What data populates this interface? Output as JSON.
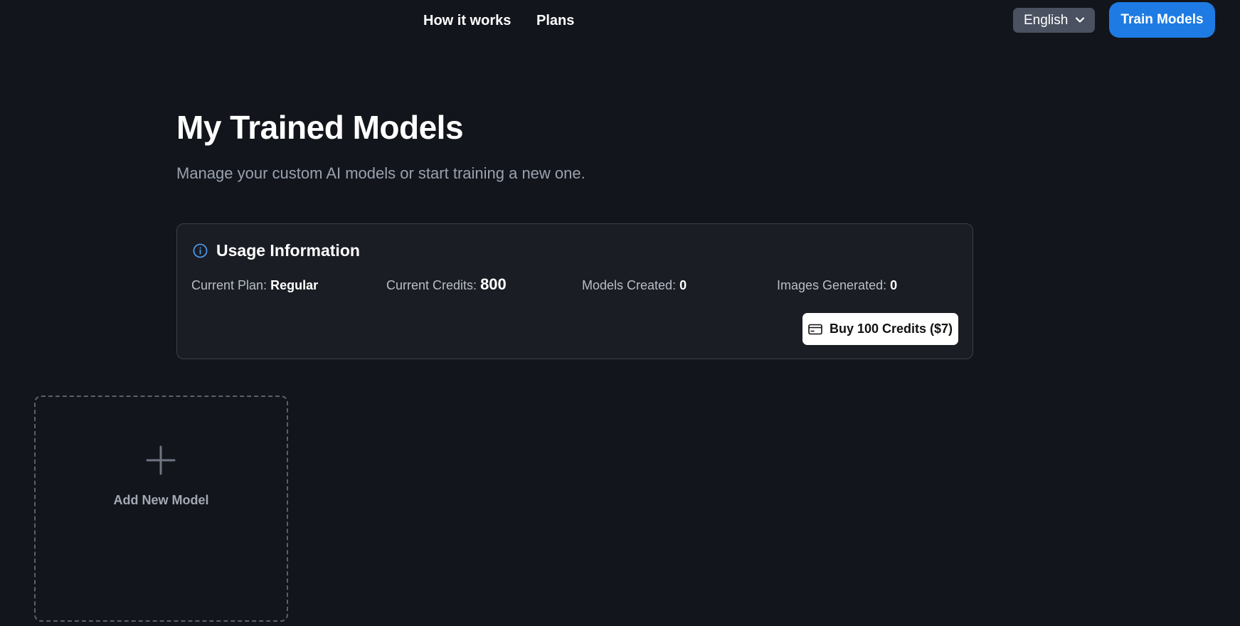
{
  "nav": {
    "how_it_works": "How it works",
    "plans": "Plans",
    "language": "English",
    "train_models": "Train Models"
  },
  "header": {
    "title": "My Trained Models",
    "subtitle": "Manage your custom AI models or start training a new one."
  },
  "usage": {
    "title": "Usage Information",
    "plan_label": "Current Plan:",
    "plan_value": "Regular",
    "credits_label": "Current Credits:",
    "credits_value": "800",
    "models_label": "Models Created:",
    "models_value": "0",
    "images_label": "Images Generated:",
    "images_value": "0",
    "buy_button": "Buy 100 Credits ($7)"
  },
  "models": {
    "add_label": "Add New Model"
  },
  "colors": {
    "background": "#12151b",
    "accent": "#1e7be3",
    "info": "#4f9cf0"
  },
  "icons": {
    "language_dropdown": "chevron-down-icon",
    "usage": "info-icon",
    "buy": "credit-card-icon",
    "add": "plus-icon"
  }
}
